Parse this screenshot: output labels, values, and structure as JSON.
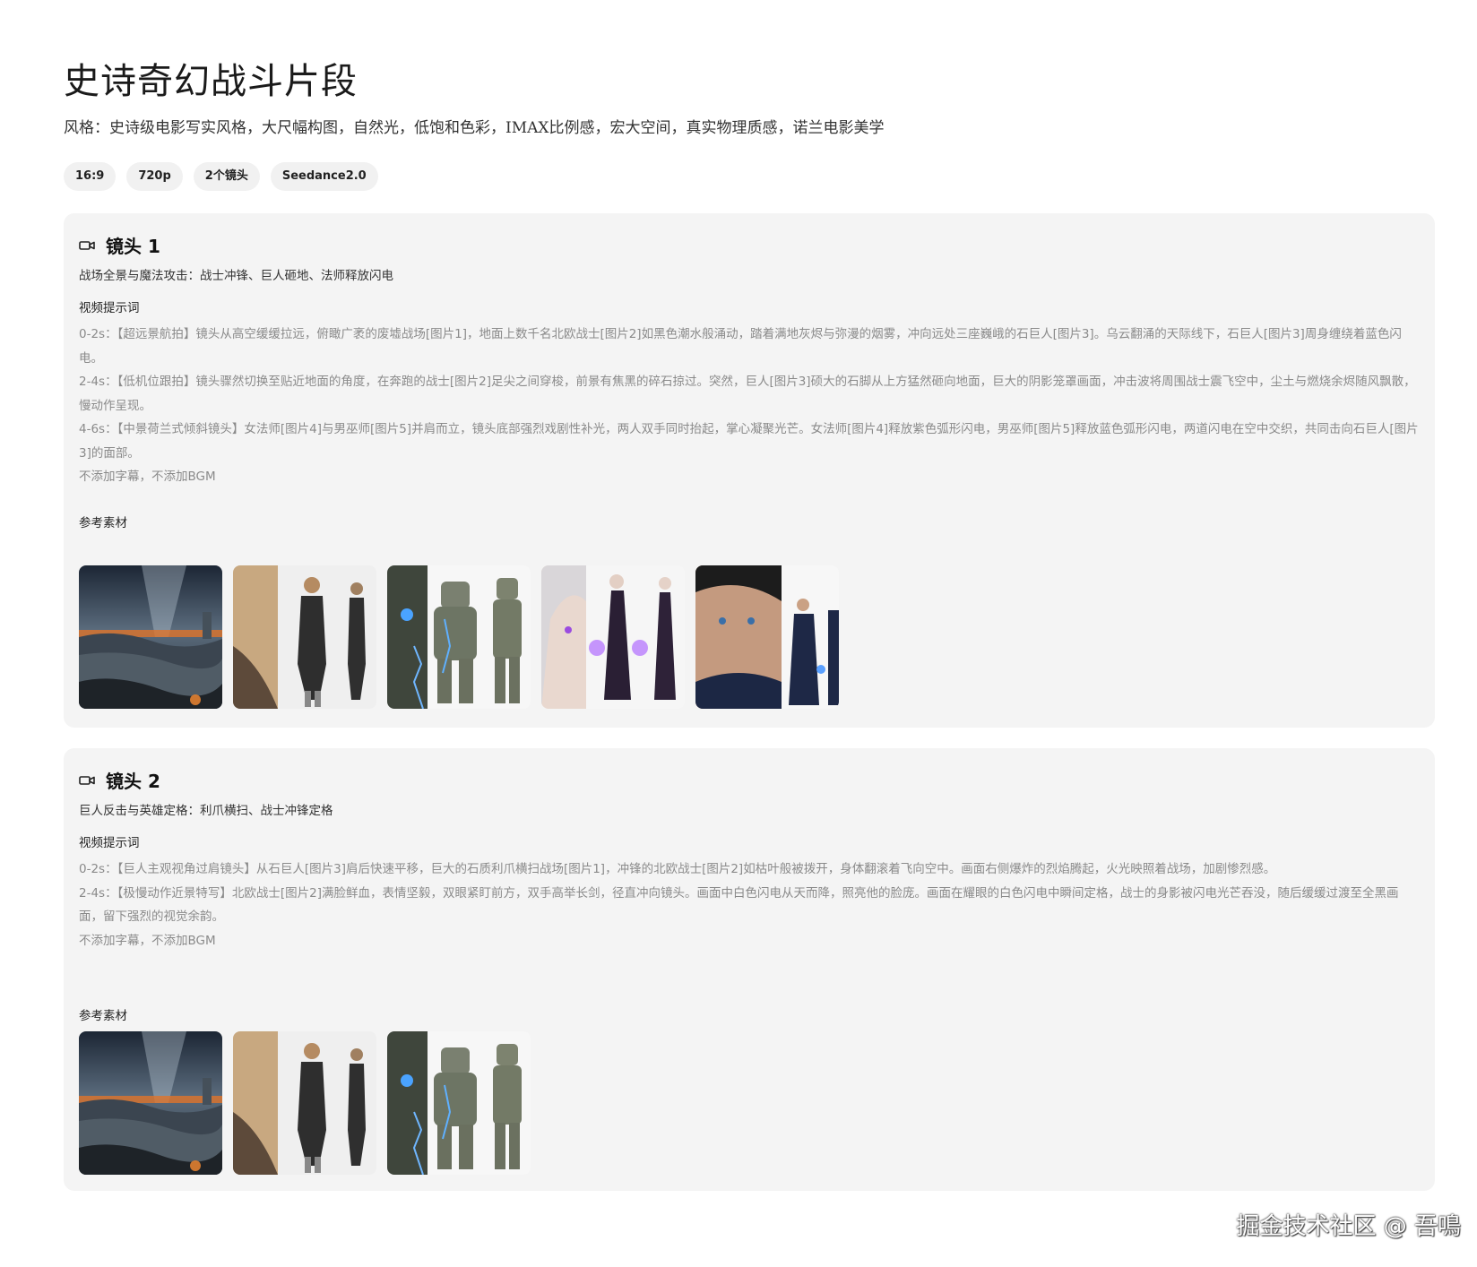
{
  "header": {
    "title": "史诗奇幻战斗片段",
    "style": "风格：史诗级电影写实风格，大尺幅构图，自然光，低饱和色彩，IMAX比例感，宏大空间，真实物理质感，诺兰电影美学",
    "tags": [
      "16:9",
      "720p",
      "2个镜头",
      "Seedance2.0"
    ]
  },
  "icons": {
    "shot": "video-camera-icon"
  },
  "labels": {
    "prompt": "视频提示词",
    "refs": "参考素材"
  },
  "shots": [
    {
      "title": "镜头 1",
      "subtitle": "战场全景与魔法攻击：战士冲锋、巨人砸地、法师释放闪电",
      "lines": [
        "0-2s：【超远景航拍】镜头从高空缓缓拉远，俯瞰广袤的废墟战场[图片1]，地面上数千名北欧战士[图片2]如黑色潮水般涌动，踏着满地灰烬与弥漫的烟雾，冲向远处三座巍峨的石巨人[图片3]。乌云翻涌的天际线下，石巨人[图片3]周身缠绕着蓝色闪电。",
        "2-4s：【低机位跟拍】镜头骤然切换至贴近地面的角度，在奔跑的战士[图片2]足尖之间穿梭，前景有焦黑的碎石掠过。突然，巨人[图片3]硕大的石脚从上方猛然砸向地面，巨大的阴影笼罩画面，冲击波将周围战士震飞空中，尘土与燃烧余烬随风飘散，慢动作呈现。",
        "4-6s：【中景荷兰式倾斜镜头】女法师[图片4]与男巫师[图片5]并肩而立，镜头底部强烈戏剧性补光，两人双手同时抬起，掌心凝聚光芒。女法师[图片4]释放紫色弧形闪电，男巫师[图片5]释放蓝色弧形闪电，两道闪电在空中交织，共同击向石巨人[图片3]的面部。",
        "不添加字幕，不添加BGM"
      ],
      "refs": [
        "battlefield",
        "warrior",
        "golem",
        "sorceress",
        "wizard"
      ]
    },
    {
      "title": "镜头 2",
      "subtitle": "巨人反击与英雄定格：利爪横扫、战士冲锋定格",
      "lines": [
        "0-2s：【巨人主观视角过肩镜头】从石巨人[图片3]肩后快速平移，巨大的石质利爪横扫战场[图片1]，冲锋的北欧战士[图片2]如枯叶般被拨开，身体翻滚着飞向空中。画面右侧爆炸的烈焰腾起，火光映照着战场，加剧惨烈感。",
        "2-4s：【极慢动作近景特写】北欧战士[图片2]满脸鲜血，表情坚毅，双眼紧盯前方，双手高举长剑，径直冲向镜头。画面中白色闪电从天而降，照亮他的脸庞。画面在耀眼的白色闪电中瞬间定格，战士的身影被闪电光芒吞没，随后缓缓过渡至全黑画面，留下强烈的视觉余韵。",
        "不添加字幕，不添加BGM"
      ],
      "refs": [
        "battlefield",
        "warrior",
        "golem"
      ]
    }
  ],
  "watermark": "掘金技术社区 @ 吾鳴"
}
